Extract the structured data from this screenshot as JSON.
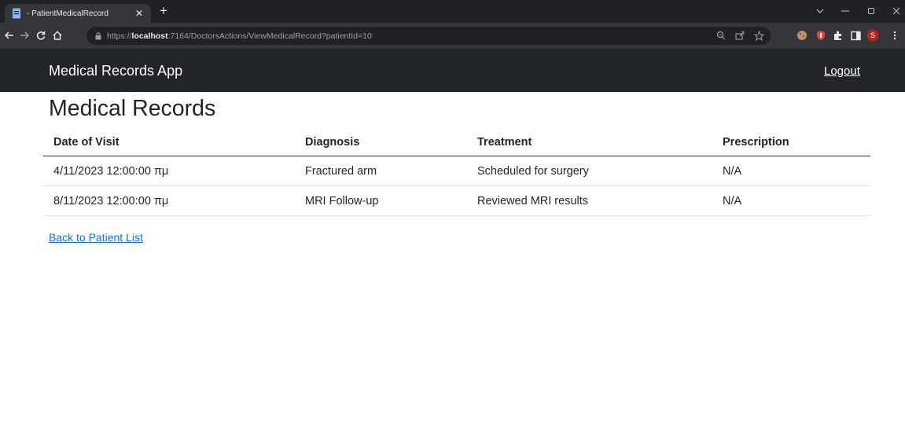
{
  "browser": {
    "tab_title": "- PatientMedicalRecord",
    "new_tab_symbol": "+",
    "url_scheme": "https://",
    "url_host": "localhost",
    "url_rest": ":7164/DoctorsActions/ViewMedicalRecord?patientId=10",
    "profile_initial": "S",
    "profile_color": "#b3261e",
    "chrome_dark": "#202124",
    "chrome_toolbar": "#35363a"
  },
  "app": {
    "brand": "Medical Records App",
    "logout": "Logout",
    "navbar_color": "#212529",
    "link_color": "#0d6efd"
  },
  "page": {
    "title": "Medical Records",
    "back_link": "Back to Patient List"
  },
  "table": {
    "headers": [
      "Date of Visit",
      "Diagnosis",
      "Treatment",
      "Prescription"
    ],
    "rows": [
      [
        "4/11/2023 12:00:00 πμ",
        "Fractured arm",
        "Scheduled for surgery",
        "N/A"
      ],
      [
        "8/11/2023 12:00:00 πμ",
        "MRI Follow-up",
        "Reviewed MRI results",
        "N/A"
      ]
    ]
  }
}
